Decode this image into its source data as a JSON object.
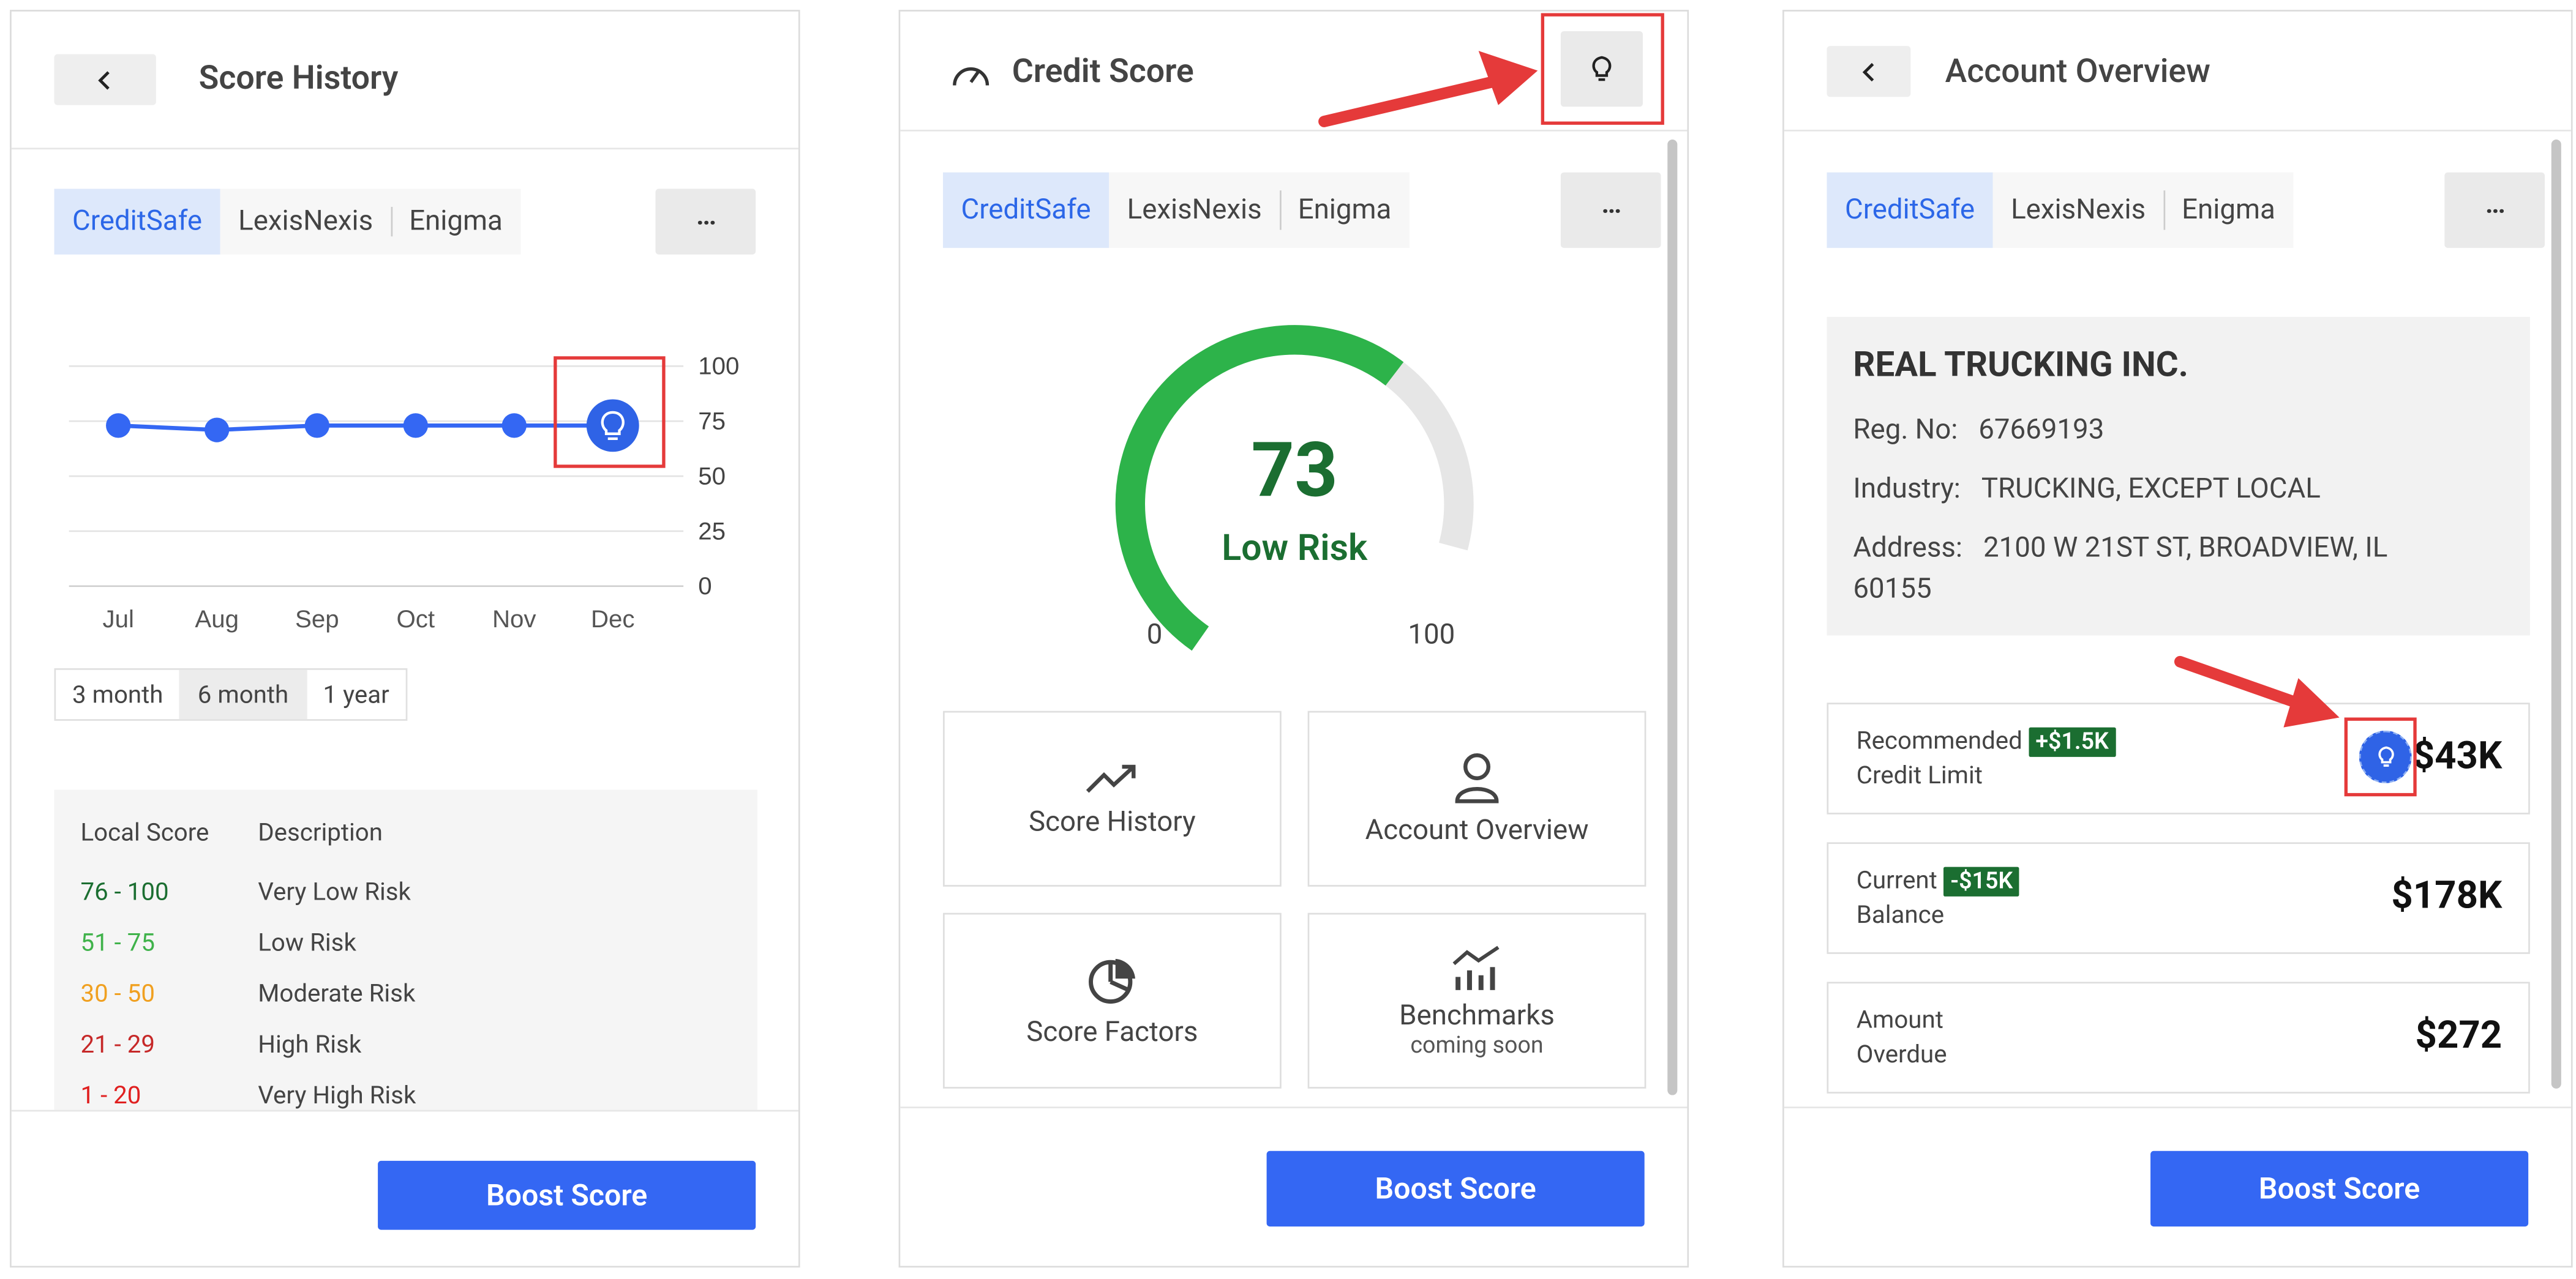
{
  "score_history": {
    "title": "Score History",
    "tabs": [
      "CreditSafe",
      "LexisNexis",
      "Enigma"
    ],
    "more_label": "···",
    "chart_data": {
      "type": "line",
      "categories": [
        "Jul",
        "Aug",
        "Sep",
        "Oct",
        "Nov",
        "Dec"
      ],
      "series": [
        {
          "values": [
            73,
            71,
            73,
            73,
            73,
            73
          ]
        }
      ],
      "ylim": [
        0,
        100
      ],
      "yticks": [
        "100",
        "75",
        "50",
        "25",
        "0"
      ],
      "grid": true,
      "last_point_marker": "lightbulb-icon"
    },
    "ranges": [
      "3 month",
      "6 month",
      "1 year"
    ],
    "active_range": "6 month",
    "legend": {
      "col_score": "Local Score",
      "col_desc": "Description",
      "rows": [
        {
          "range": "76 - 100",
          "desc": "Very Low Risk",
          "color": "#1b6e31"
        },
        {
          "range": "51 - 75",
          "desc": "Low Risk",
          "color": "#3fb24a"
        },
        {
          "range": "30 - 50",
          "desc": "Moderate Risk",
          "color": "#f0a020"
        },
        {
          "range": "21 - 29",
          "desc": "High Risk",
          "color": "#c62828"
        },
        {
          "range": "1 - 20",
          "desc": "Very High Risk",
          "color": "#e02020"
        }
      ]
    },
    "boost_label": "Boost Score"
  },
  "credit_score": {
    "title": "Credit Score",
    "tabs": [
      "CreditSafe",
      "LexisNexis",
      "Enigma"
    ],
    "more_label": "···",
    "gauge": {
      "value": "73",
      "label": "Low Risk",
      "min": "0",
      "max": "100",
      "fraction": 0.73,
      "color": "#2db34a",
      "track": "#e6e6e6",
      "text_color": "#1b6e31"
    },
    "tiles": [
      {
        "label": "Score History",
        "sub": "",
        "icon": "trending-up-icon"
      },
      {
        "label": "Account Overview",
        "sub": "",
        "icon": "person-icon"
      },
      {
        "label": "Score Factors",
        "sub": "",
        "icon": "pie-chart-icon"
      },
      {
        "label": "Benchmarks",
        "sub": "coming soon",
        "icon": "bar-line-chart-icon"
      }
    ],
    "boost_label": "Boost Score"
  },
  "account_overview": {
    "title": "Account Overview",
    "tabs": [
      "CreditSafe",
      "LexisNexis",
      "Enigma"
    ],
    "more_label": "···",
    "company": "REAL TRUCKING INC.",
    "reg_label": "Reg. No:",
    "reg_value": "67669193",
    "industry_label": "Industry:",
    "industry_value": "TRUCKING, EXCEPT LOCAL",
    "address_label": "Address:",
    "address_line1": "2100 W 21ST ST, BROADVIEW, IL",
    "address_line2": "60155",
    "cards": [
      {
        "label1": "Recommended",
        "label2": "Credit Limit",
        "delta": "+$1.5K",
        "value": "$43K"
      },
      {
        "label1": "Current",
        "label2": "Balance",
        "delta": "-$15K",
        "value": "$178K"
      },
      {
        "label1": "Amount",
        "label2": "Overdue",
        "delta": "",
        "value": "$272"
      }
    ],
    "boost_label": "Boost Score"
  },
  "colors": {
    "accent": "#3467f3",
    "tab_active_bg": "#dde8fb",
    "tab_active_text": "#2c67e8",
    "annotation": "#e53a3a",
    "success": "#1b6e31"
  }
}
